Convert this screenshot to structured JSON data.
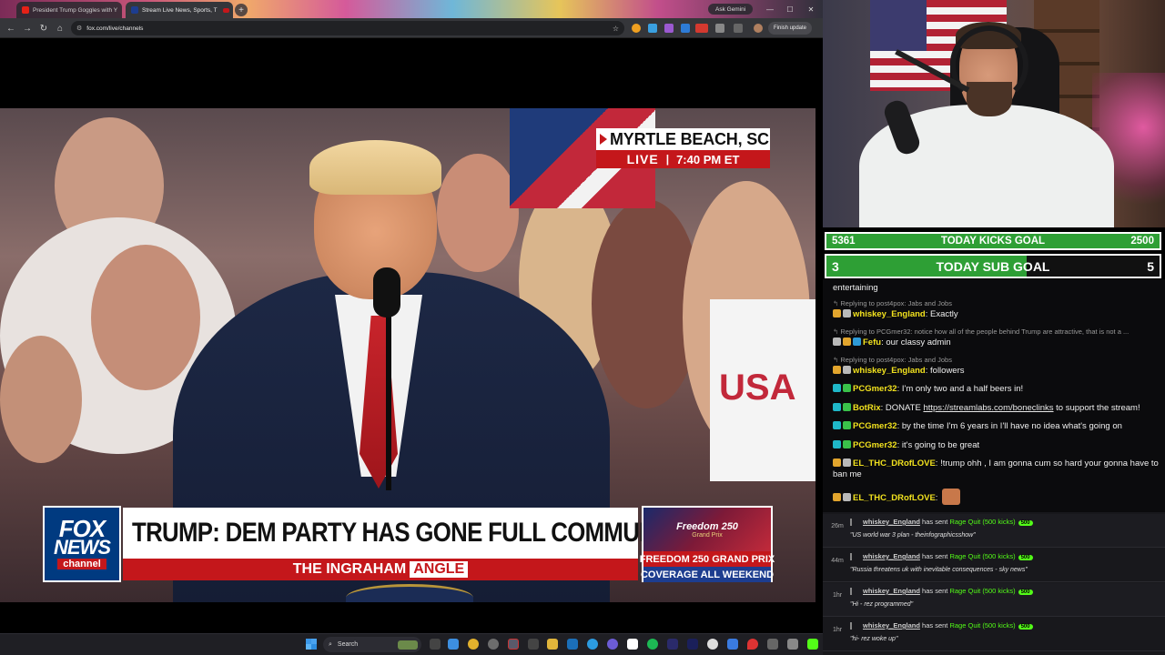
{
  "browser": {
    "tabs": [
      {
        "title": "President Trump Goggles with Y",
        "active": false
      },
      {
        "title": "Stream Live News, Sports, T",
        "active": true
      }
    ],
    "ask_gemini": "Ask Gemini",
    "url": "fox.com/live/channels",
    "finish_update": "Finish update"
  },
  "broadcast": {
    "location": "MYRTLE BEACH, SC",
    "live_label": "LIVE",
    "separator": "|",
    "time": "7:40 PM ET",
    "network_logo": {
      "line1": "FOX",
      "line2": "NEWS",
      "line3": "channel"
    },
    "headline": "TRUMP: DEM PARTY HAS GONE FULL COMMUNIST",
    "show_name_1": "THE INGRAHAM",
    "show_name_2": "ANGLE",
    "promo_title": "Freedom 250",
    "promo_sub": "Grand Prix",
    "promo_line1": "FREEDOM 250 GRAND PRIX",
    "promo_line2": "COVERAGE ALL WEEKEND"
  },
  "taskbar": {
    "search_placeholder": "Search"
  },
  "goals": {
    "kicks": {
      "current": "5361",
      "label": "TODAY KICKS GOAL",
      "target": "2500"
    },
    "subs": {
      "current": "3",
      "label": "TODAY SUB GOAL",
      "target": "5",
      "progress": 0.6
    }
  },
  "chat": [
    {
      "kind": "text",
      "text": "entertaining"
    },
    {
      "kind": "reply",
      "text": "Replying to post4pox: Jabs and Jobs"
    },
    {
      "kind": "msg",
      "user": "whiskey_England",
      "color": "#f2e21e",
      "badges": [
        "#e2a52d",
        "#b9b9b9"
      ],
      "text": "Exactly"
    },
    {
      "kind": "reply",
      "text": "Replying to PCGmer32: notice how all of the people behind Trump are attractive, that is not a ..."
    },
    {
      "kind": "msg",
      "user": "Fefu",
      "color": "#f2e21e",
      "badges": [
        "#b9b9b9",
        "#e2a52d",
        "#2e9ad6"
      ],
      "text": "our classy admin"
    },
    {
      "kind": "reply",
      "text": "Replying to post4pox: Jabs and Jobs"
    },
    {
      "kind": "msg",
      "user": "whiskey_England",
      "color": "#f2e21e",
      "badges": [
        "#e2a52d",
        "#b9b9b9"
      ],
      "text": "followers"
    },
    {
      "kind": "msg",
      "user": "PCGmer32",
      "color": "#f2e21e",
      "badges": [
        "#1fb8c9",
        "#3ac24a"
      ],
      "text": "I'm only two and a half beers in!"
    },
    {
      "kind": "msg",
      "user": "BotRix",
      "color": "#f2e21e",
      "badges": [
        "#1fb8c9",
        "#3ac24a"
      ],
      "text": "DONATE ",
      "link": "https://streamlabs.com/boneclinks",
      "after": " to support the stream!"
    },
    {
      "kind": "msg",
      "user": "PCGmer32",
      "color": "#f2e21e",
      "badges": [
        "#1fb8c9",
        "#3ac24a"
      ],
      "text": "by the time I'm 6 years in I'll have no idea what's going on"
    },
    {
      "kind": "msg",
      "user": "PCGmer32",
      "color": "#f2e21e",
      "badges": [
        "#1fb8c9",
        "#3ac24a"
      ],
      "text": "it's going to be great"
    },
    {
      "kind": "msg",
      "user": "EL_THC_DRofLOVE",
      "color": "#f2e21e",
      "badges": [
        "#e2a52d",
        "#b9b9b9"
      ],
      "text": "!trump ohh , I am gonna cum so hard your gonna have to ban me"
    },
    {
      "kind": "msg",
      "user": "EL_THC_DRofLOVE",
      "color": "#f2e21e",
      "badges": [
        "#e2a52d",
        "#b9b9b9"
      ],
      "text": "",
      "emote": true
    }
  ],
  "alerts": [
    {
      "time": "26m",
      "user": "whiskey_England",
      "verb": "has sent",
      "item": "Rage Quit (500 kicks)",
      "pill": "500",
      "message": "\"US world war 3 plan - theinfographicsshow\""
    },
    {
      "time": "44m",
      "user": "whiskey_England",
      "verb": "has sent",
      "item": "Rage Quit (500 kicks)",
      "pill": "500",
      "message": "\"Russia threatens uk with inevitable consequences - sky news\""
    },
    {
      "time": "1hr",
      "user": "whiskey_England",
      "verb": "has sent",
      "item": "Rage Quit (500 kicks)",
      "pill": "500",
      "message": "\"Hi - rez programmed\""
    },
    {
      "time": "1hr",
      "user": "whiskey_England",
      "verb": "has sent",
      "item": "Rage Quit (500 kicks)",
      "pill": "500",
      "message": "\"hi- rez woke up\""
    }
  ]
}
